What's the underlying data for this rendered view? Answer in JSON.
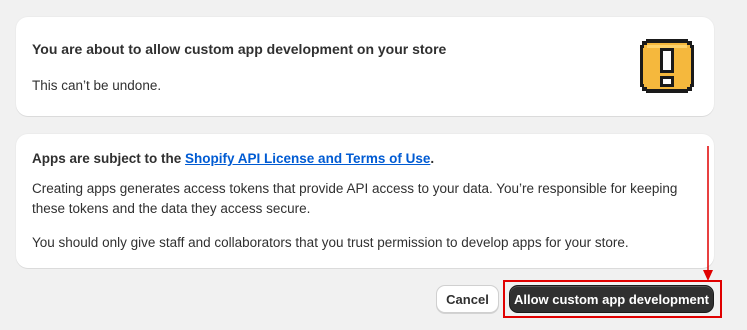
{
  "warning_card": {
    "title": "You are about to allow custom app development on your store",
    "subtitle": "This can’t be undone.",
    "icon": "warning-exclamation-icon"
  },
  "info_card": {
    "heading_prefix": "Apps are subject to the ",
    "heading_link": "Shopify API License and Terms of Use",
    "heading_suffix": ".",
    "paragraph_1": "Creating apps generates access tokens that provide API access to your data. You’re responsible for keeping these tokens and the data they access secure.",
    "paragraph_2": "You should only give staff and collaborators that you trust permission to develop apps for your store."
  },
  "actions": {
    "cancel_label": "Cancel",
    "allow_label": "Allow custom app development"
  },
  "colors": {
    "background": "#f1f1f1",
    "card": "#ffffff",
    "link": "#005bd3",
    "primary_button": "#303030",
    "annotation": "#e00000",
    "warning_yellow": "#f5b83d"
  }
}
